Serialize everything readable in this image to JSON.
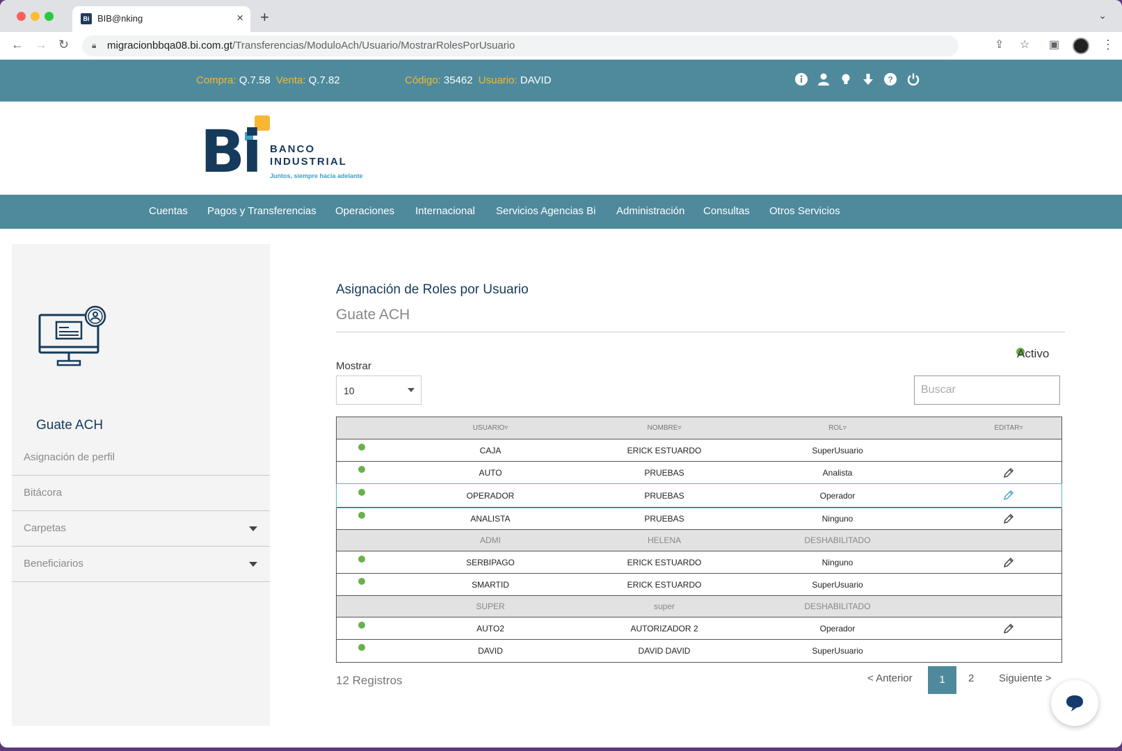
{
  "browser": {
    "tab_title": "BIB@nking",
    "favicon_text": "Bi",
    "url_host": "migracionbbqa08.bi.com.gt",
    "url_path": "/Transferencias/ModuloAch/Usuario/MostrarRolesPorUsuario"
  },
  "topbar": {
    "compra_label": "Compra:",
    "compra_value": "Q.7.58",
    "venta_label": "Venta:",
    "venta_value": "Q.7.82",
    "codigo_label": "Código:",
    "codigo_value": "35462",
    "usuario_label": "Usuario:",
    "usuario_value": "DAVID",
    "icons": [
      "info-icon",
      "user-icon",
      "lightbulb-icon",
      "download-icon",
      "help-icon",
      "power-icon"
    ]
  },
  "logo": {
    "mark": "Bi",
    "line1": "BANCO",
    "line2": "INDUSTRIAL",
    "tagline": "Juntos, siempre hacia adelante"
  },
  "nav": {
    "items": [
      "Cuentas",
      "Pagos y Transferencias",
      "Operaciones",
      "Internacional",
      "Servicios Agencias Bi",
      "Administración",
      "Consultas",
      "Otros Servicios"
    ]
  },
  "sidebar": {
    "title": "Guate ACH",
    "items": [
      "Asignación de perfil",
      "Bitácora",
      "Carpetas",
      "Beneficiarios"
    ]
  },
  "content": {
    "title": "Asignación de Roles por Usuario",
    "subtitle": "Guate ACH",
    "activo_label": "Activo",
    "mostrar_label": "Mostrar",
    "mostrar_value": "10",
    "search_placeholder": "Buscar",
    "columns": [
      "USUARIO▿",
      "NOMBRE▿",
      "ROL▿",
      "EDITAR▿"
    ],
    "rows": [
      {
        "usuario": "CAJA",
        "nombre": "ERICK ESTUARDO",
        "rol": "SuperUsuario"
      },
      {
        "usuario": "AUTO",
        "nombre": "PRUEBAS",
        "rol": "Analista"
      },
      {
        "usuario": "OPERADOR",
        "nombre": "PRUEBAS",
        "rol": "Operador"
      },
      {
        "usuario": "ANALISTA",
        "nombre": "PRUEBAS",
        "rol": "Ninguno"
      },
      {
        "usuario": "ADMI",
        "nombre": "HELENA",
        "rol": "DESHABILITADO"
      },
      {
        "usuario": "SERBIPAGO",
        "nombre": "ERICK ESTUARDO",
        "rol": "Ninguno"
      },
      {
        "usuario": "SMARTID",
        "nombre": "ERICK ESTUARDO",
        "rol": "SuperUsuario"
      },
      {
        "usuario": "SUPER",
        "nombre": "super",
        "rol": "DESHABILITADO"
      },
      {
        "usuario": "AUTO2",
        "nombre": "AUTORIZADOR 2",
        "rol": "Operador"
      },
      {
        "usuario": "DAVID",
        "nombre": "DAVID DAVID",
        "rol": "SuperUsuario"
      }
    ],
    "registros": "12 Registros",
    "pagination": {
      "prev": "< Anterior",
      "page1": "1",
      "page2": "2",
      "next": "Siguiente >"
    }
  },
  "colors": {
    "brand_teal": "#4e8a9c",
    "brand_navy": "#153a5b",
    "accent_yellow": "#f7b733",
    "status_green": "#6ab04c"
  }
}
